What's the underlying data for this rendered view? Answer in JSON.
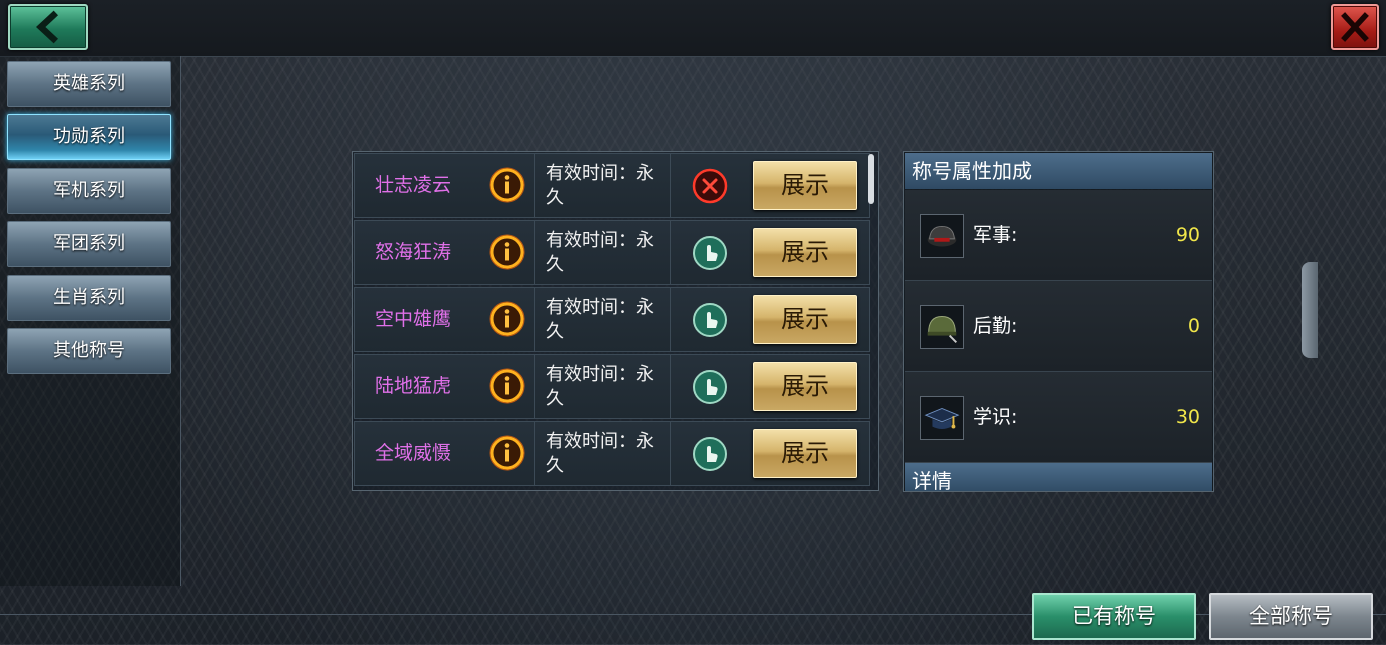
{
  "nav": {
    "back_icon": "chevron-left-icon",
    "close_icon": "close-x-icon"
  },
  "sidebar": {
    "items": [
      {
        "label": "英雄系列",
        "active": false
      },
      {
        "label": "功勋系列",
        "active": true
      },
      {
        "label": "军机系列",
        "active": false
      },
      {
        "label": "军团系列",
        "active": false
      },
      {
        "label": "生肖系列",
        "active": false
      },
      {
        "label": "其他称号",
        "active": false
      }
    ]
  },
  "titles": [
    {
      "name": "壮志凌云",
      "time": "有效时间：永久",
      "status": "unequip",
      "button": "展示"
    },
    {
      "name": "怒海狂涛",
      "time": "有效时间：永久",
      "status": "equip",
      "button": "展示"
    },
    {
      "name": "空中雄鹰",
      "time": "有效时间：永久",
      "status": "equip",
      "button": "展示"
    },
    {
      "name": "陆地猛虎",
      "time": "有效时间：永久",
      "status": "equip",
      "button": "展示"
    },
    {
      "name": "全域威慑",
      "time": "有效时间：永久",
      "status": "equip",
      "button": "展示"
    }
  ],
  "bonus_panel": {
    "header": "称号属性加成",
    "attributes": [
      {
        "label": "军事:",
        "value": "90",
        "icon": "military-helmet-icon"
      },
      {
        "label": "后勤:",
        "value": "0",
        "icon": "logistics-helmet-icon"
      },
      {
        "label": "学识:",
        "value": "30",
        "icon": "graduation-cap-icon"
      }
    ],
    "detail_header": "详情"
  },
  "footer": {
    "owned_label": "已有称号",
    "all_label": "全部称号"
  },
  "colors": {
    "title_name": "#e070e8",
    "attr_value": "#f0e64a",
    "accent_green": "#2a8f6a",
    "accent_red": "#a61c16"
  }
}
